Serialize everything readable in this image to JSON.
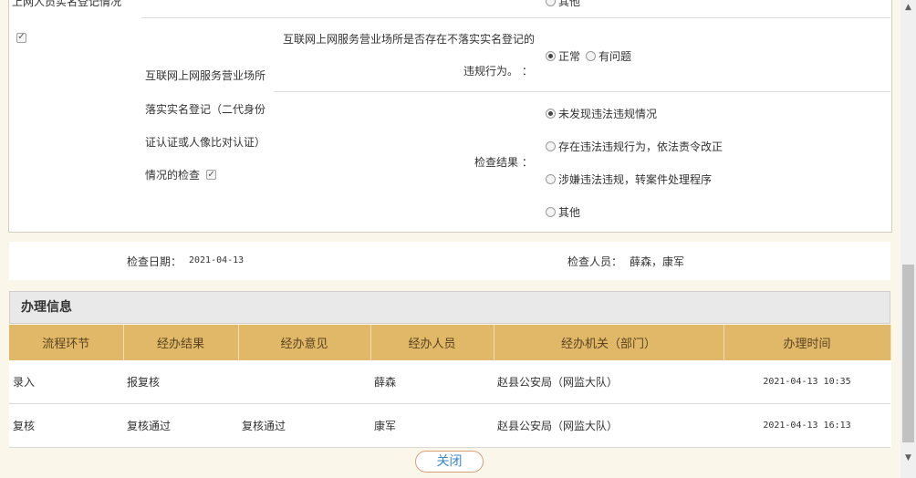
{
  "inspection": {
    "prev_item_label": "上网人员实名登记情况",
    "prev_option": "其他",
    "item_label_lines": [
      "互联网上网服务营业场所",
      "落实实名登记（二代身份",
      "证认证或人像比对认证）",
      "情况的检查"
    ],
    "question_line1": "互联网上网服务营业场所是否存在不落实实名登记的",
    "question_line2": "违规行为。 ：",
    "question_options": [
      "正常",
      "有问题"
    ],
    "result_label": "检查结果 ：",
    "result_options": [
      "未发现违法违规情况",
      "存在违法违规行为，依法责令改正",
      "涉嫌违法违规，转案件处理程序",
      "其他"
    ]
  },
  "meta": {
    "date_label": "检查日期：",
    "date_value": "2021-04-13",
    "inspector_label": "检查人员：",
    "inspector_value": "薛森，康军"
  },
  "process": {
    "title": "办理信息",
    "columns": [
      "流程环节",
      "经办结果",
      "经办意见",
      "经办人员",
      "经办机关（部门）",
      "办理时间"
    ],
    "rows": [
      {
        "step": "录入",
        "result": "报复核",
        "opinion": "",
        "person": "薛森",
        "org": "赵县公安局（网监大队）",
        "time": "2021-04-13 10:35"
      },
      {
        "step": "复核",
        "result": "复核通过",
        "opinion": "复核通过",
        "person": "康军",
        "org": "赵县公安局（网监大队）",
        "time": "2021-04-13 16:13"
      }
    ]
  },
  "buttons": {
    "close": "关闭"
  }
}
